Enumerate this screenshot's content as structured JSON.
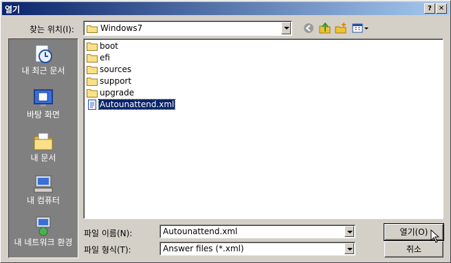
{
  "window": {
    "title": "열기"
  },
  "titlebar": {
    "help_label": "?",
    "close_label": "✕"
  },
  "location": {
    "label": "찾는 위치(I):",
    "value": "Windows7"
  },
  "places": [
    {
      "name": "recent",
      "label": "내 최근 문서"
    },
    {
      "name": "desktop",
      "label": "바탕 화면"
    },
    {
      "name": "documents",
      "label": "내 문서"
    },
    {
      "name": "computer",
      "label": "내 컴퓨터"
    },
    {
      "name": "network",
      "label": "내 네트워크 환경"
    }
  ],
  "files": [
    {
      "name": "boot",
      "type": "folder"
    },
    {
      "name": "efi",
      "type": "folder"
    },
    {
      "name": "sources",
      "type": "folder"
    },
    {
      "name": "support",
      "type": "folder"
    },
    {
      "name": "upgrade",
      "type": "folder"
    },
    {
      "name": "Autounattend.xml",
      "type": "xml-file",
      "selected": true
    }
  ],
  "filename": {
    "label": "파일 이름(N):",
    "value": "Autounattend.xml"
  },
  "filetype": {
    "label": "파일 형식(T):",
    "value": "Answer files (*.xml)"
  },
  "buttons": {
    "open": "열기(O)",
    "cancel": "취소"
  },
  "icons": {
    "back": "back-arrow-icon",
    "up": "up-folder-icon",
    "new_folder": "new-folder-icon",
    "views": "views-menu-icon"
  }
}
